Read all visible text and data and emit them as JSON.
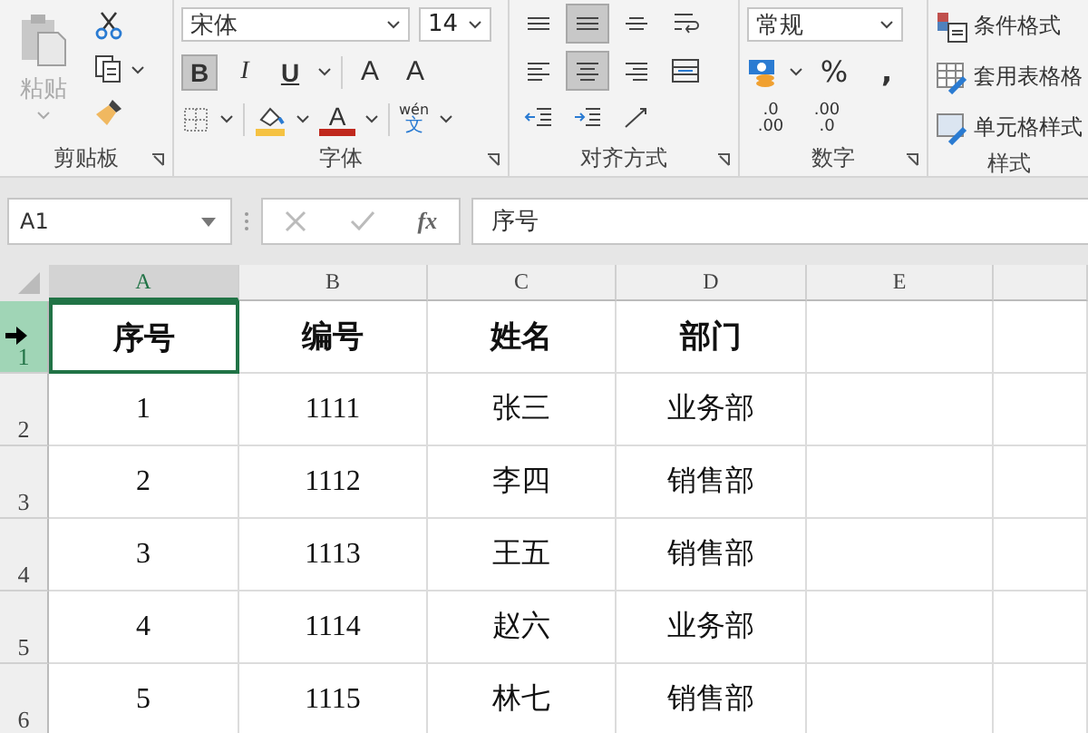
{
  "ribbon": {
    "clipboard": {
      "paste_label": "粘贴",
      "group_label": "剪贴板"
    },
    "font": {
      "font_name": "宋体",
      "font_size": "14",
      "group_label": "字体",
      "format_buttons": [
        {
          "kind": "bold",
          "label": "B",
          "selected": true
        },
        {
          "kind": "italic",
          "label": "I",
          "selected": false
        },
        {
          "kind": "underline",
          "label": "U",
          "selected": false
        }
      ],
      "grow_label": "A",
      "shrink_label": "A",
      "color_label": "A",
      "phonetic_top": "wén",
      "phonetic_bottom": "文"
    },
    "alignment": {
      "group_label": "对齐方式",
      "buttons": [
        {
          "kind": "top",
          "selected": false
        },
        {
          "kind": "middle",
          "selected": true
        },
        {
          "kind": "bottom",
          "selected": false
        },
        {
          "kind": "wrap",
          "selected": false
        },
        {
          "kind": "left",
          "selected": false
        },
        {
          "kind": "center",
          "selected": true
        },
        {
          "kind": "right",
          "selected": false
        },
        {
          "kind": "merge",
          "selected": false
        },
        {
          "kind": "outdent",
          "selected": false
        },
        {
          "kind": "indent",
          "selected": false
        },
        {
          "kind": "orientation",
          "selected": false
        }
      ]
    },
    "number": {
      "format": "常规",
      "percent": "%",
      "comma": ",",
      "increase_top": ".0",
      "increase_bottom": ".00",
      "decrease_top": ".00",
      "decrease_bottom": ".0",
      "group_label": "数字"
    },
    "styles": {
      "items": [
        {
          "kind": "conditional",
          "label": "条件格式"
        },
        {
          "kind": "table",
          "label": "套用表格格"
        },
        {
          "kind": "cell",
          "label": "单元格样式"
        }
      ],
      "group_label": "样式"
    }
  },
  "formula_bar": {
    "name_box": "A1",
    "fx": "fx",
    "content": "序号"
  },
  "sheet": {
    "columns": [
      {
        "label": "A",
        "selected": true
      },
      {
        "label": "B",
        "selected": false
      },
      {
        "label": "C",
        "selected": false
      },
      {
        "label": "D",
        "selected": false
      },
      {
        "label": "E",
        "selected": false
      }
    ],
    "rows": [
      {
        "number": "1",
        "selected": true,
        "header": true,
        "cells": [
          "序号",
          "编号",
          "姓名",
          "部门"
        ]
      },
      {
        "number": "2",
        "selected": false,
        "header": false,
        "cells": [
          "1",
          "1111",
          "张三",
          "业务部"
        ]
      },
      {
        "number": "3",
        "selected": false,
        "header": false,
        "cells": [
          "2",
          "1112",
          "李四",
          "销售部"
        ]
      },
      {
        "number": "4",
        "selected": false,
        "header": false,
        "cells": [
          "3",
          "1113",
          "王五",
          "销售部"
        ]
      },
      {
        "number": "5",
        "selected": false,
        "header": false,
        "cells": [
          "4",
          "1114",
          "赵六",
          "业务部"
        ]
      },
      {
        "number": "6",
        "selected": false,
        "header": false,
        "cells": [
          "5",
          "1115",
          "林七",
          "销售部"
        ]
      }
    ]
  }
}
